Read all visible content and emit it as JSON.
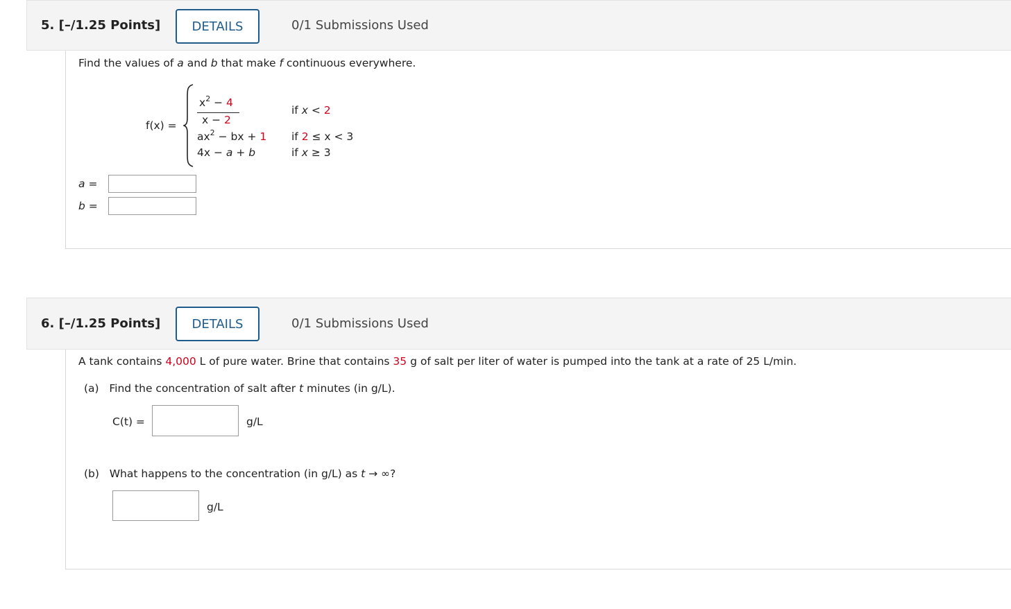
{
  "q5": {
    "number": "5.",
    "points": "[–/1.25 Points]",
    "details_label": "DETAILS",
    "submissions": "0/1 Submissions Used",
    "prompt_a": "Find the values of ",
    "var_a": "a",
    "and": " and ",
    "var_b": "b",
    "prompt_b": " that make ",
    "var_f": "f",
    "prompt_c": " continuous everywhere.",
    "fx": "f(x) =",
    "case1_num_x": "x",
    "case1_num_exp": "2",
    "case1_num_rest": " − ",
    "case1_num_const": "4",
    "case1_den_left": "x − ",
    "case1_den_const": "2",
    "case1_cond_left": "if ",
    "case1_cond_var": "x",
    "case1_cond_mid": " < ",
    "case1_cond_const": "2",
    "case2_a": "ax",
    "case2_exp": "2",
    "case2_rest": " − bx + ",
    "case2_const": "1",
    "case2_cond_left": "if ",
    "case2_cond_const": "2",
    "case2_cond_right": " ≤ x < 3",
    "case3_left": "4x − ",
    "case3_a": "a",
    "case3_mid": " + ",
    "case3_b": "b",
    "case3_cond_left": "if ",
    "case3_cond_var": "x",
    "case3_cond_right": " ≥ 3",
    "label_a": "a",
    "label_b": "b",
    "equals": "="
  },
  "q6": {
    "number": "6.",
    "points": "[–/1.25 Points]",
    "details_label": "DETAILS",
    "submissions": "0/1 Submissions Used",
    "prompt_1": "A tank contains ",
    "volume": "4,000",
    "prompt_2": " L of pure water. Brine that contains ",
    "salt": "35",
    "prompt_3": " g of salt per liter of water is pumped into the tank at a rate of 25 L/min.",
    "part_a_label": "(a)",
    "part_a_text_1": "Find the concentration of salt after ",
    "part_a_var": "t",
    "part_a_text_2": " minutes (in g/L).",
    "ct_label": "C(t) =",
    "unit_a": "g/L",
    "part_b_label": "(b)",
    "part_b_text_1": "What happens to the concentration (in g/L) as ",
    "part_b_var": "t",
    "part_b_text_2": " → ∞?",
    "unit_b": "g/L"
  }
}
